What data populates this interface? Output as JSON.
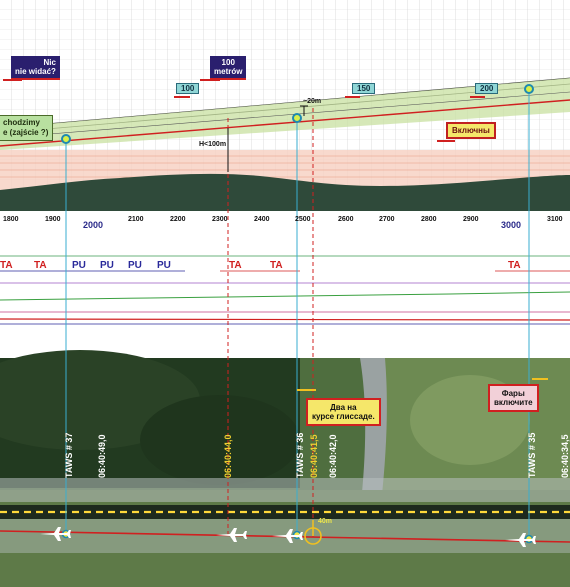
{
  "profile": {
    "labels": {
      "nic": [
        "Nic",
        "nie widać?"
      ],
      "metrow": [
        "100",
        "metrów"
      ],
      "zajscie": [
        "chodzimy",
        "e (zajście ?)"
      ],
      "vklyuchny": "Включны",
      "h100": "H<100m",
      "d20": "~20m"
    },
    "gs_markers": [
      "100",
      "150",
      "200"
    ],
    "distance_ticks": [
      "1800",
      "1900",
      "2100",
      "2200",
      "2300",
      "2400",
      "2500",
      "2600",
      "2700",
      "2800",
      "2900",
      "3100"
    ],
    "distance_majors": [
      "2000",
      "3000"
    ]
  },
  "gpws": {
    "row1": [
      "TA",
      "TA",
      "TA",
      "TA",
      "TA"
    ],
    "row2": [
      "PU",
      "PU",
      "PU",
      "PU"
    ]
  },
  "satellite": {
    "boxes": {
      "dva": [
        "Два на",
        "курсе глиссаде."
      ],
      "fary": [
        "Фары",
        "включите"
      ]
    },
    "taws": [
      {
        "name": "TAWS # 37",
        "time": "06:40:49,0"
      },
      {
        "name": "TAWS # 36",
        "time": "06:40:42,0"
      },
      {
        "name": "TAWS # 35",
        "time": "06:40:34,5"
      }
    ],
    "times_yellow": [
      "06:40:44,0",
      "06:40:41,5"
    ],
    "offset": "40m"
  },
  "colors": {
    "red": "#d02020",
    "cyan": "#3aaed0",
    "terrain": "#2f4a3a",
    "ta_red": "#d02020",
    "pu_blue": "#2a2a9a"
  }
}
